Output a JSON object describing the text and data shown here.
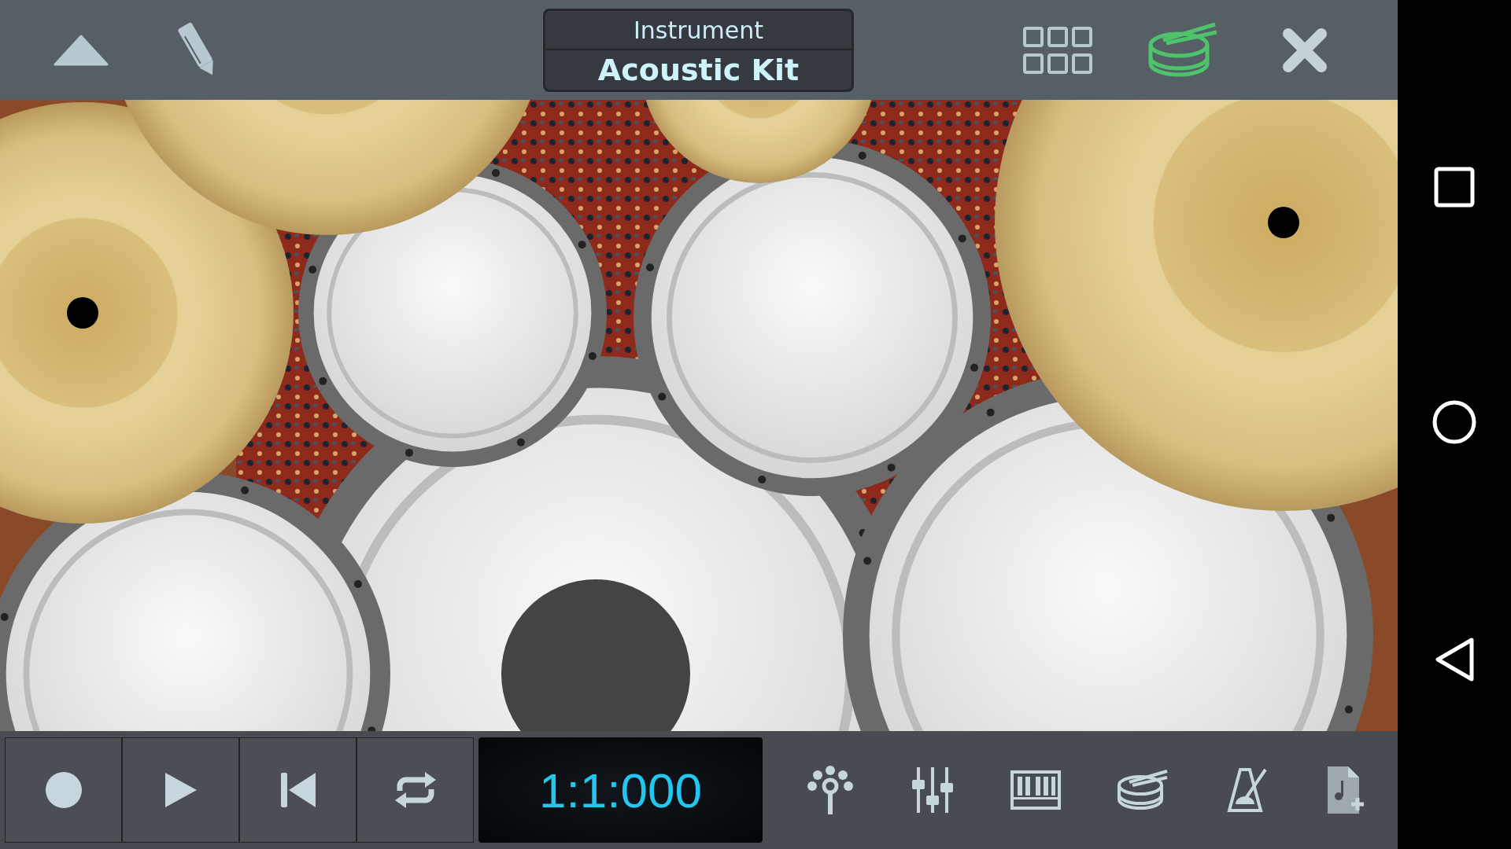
{
  "header": {
    "label": "Instrument",
    "instrument": "Acoustic Kit"
  },
  "transport": {
    "time": "1:1:000"
  }
}
